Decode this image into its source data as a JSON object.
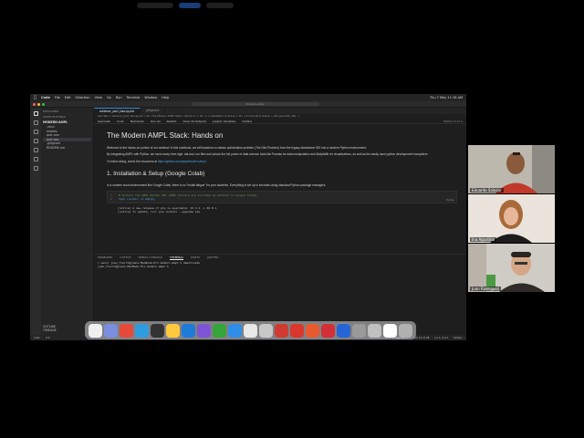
{
  "meeting": {
    "top_hint_text": "",
    "participants": [
      {
        "name": "Eduardo Salazar"
      },
      {
        "name": "Ina Agustina"
      },
      {
        "name": "Juan Rodriguez"
      }
    ]
  },
  "mac_menubar": {
    "app": "Code",
    "menus": [
      "File",
      "Edit",
      "Selection",
      "View",
      "Go",
      "Run",
      "Terminal",
      "Window",
      "Help"
    ],
    "status_right": "Thu 7 May 11:18 AM"
  },
  "vscode": {
    "search_placeholder": "modern-ampl",
    "explorer": {
      "header": "EXPLORER",
      "open_editors": "OPEN EDITORS",
      "folder": "MODERN-AMPL",
      "items": [
        ".venv",
        "models",
        "part-one",
        "part-two",
        ".gitignore",
        "README.md"
      ],
      "selected_index": 3,
      "outline": "OUTLINE",
      "timeline": "TIMELINE"
    },
    "tabs": [
      {
        "label": "webinar_part_two.ipynb",
        "active": true
      },
      {
        "label": "gitignore",
        "active": false
      }
    ],
    "breadcrumbs": "part-two > webinar_part_two.ipynb > M+ The Modern AMPL Stack: Hands on > M+ 1.1 Installation & Setup > M+ 1.2 Imports & Setup > def generate_dfs(...)",
    "nb_toolbar": [
      "Generate",
      "Code",
      "Markdown",
      "Run All",
      "Restart",
      "Clear All Outputs",
      "Jupyter Variables",
      "Outline"
    ],
    "kernel": "Python 3.11.1",
    "notebook": {
      "title": "The Modern AMPL Stack: Hands on",
      "intro": "Welcome to the hands-on portion of our webinar! In this notebook, we will transform a classic optimization problem (The Diet Problem) from the legacy standalone IDE into a modern Python environment.",
      "intro2": "By integrating AMPL with Python, we move away from rigid .dat and .run files and unlock the full power of data science tools like Pandas for data manipulation and Matplotlib for visualizations, as well as the easily used python development ecosystem.",
      "follow": "To follow along, check the resources at",
      "follow_link": "https://github.com/ampl/modern-ampl",
      "section": "1. Installation & Setup (Google Colab)",
      "section_text": "In a modern cloud environment like Google Colab, there is no \"install fatigue\" for your students. Everything is set up in seconds using standard Python package managers.",
      "code_lines": [
        {
          "ln": "1",
          "text": "# Install the AMPL Python API (AMPL Solvers are included by default in Google Colab)"
        },
        {
          "ln": "2",
          "text": "%pip install -U amplpy"
        }
      ],
      "code_lang": "Python",
      "output_lines": [
        "[notice] A new release of pip is available: 23.3.1 -> 26.0.1",
        "[notice] To update, run: pip install --upgrade pip"
      ]
    },
    "panel_tabs": [
      "PROBLEMS",
      "OUTPUT",
      "DEBUG CONSOLE",
      "TERMINAL",
      "PORTS",
      "JUPYTER"
    ],
    "active_panel": "TERMINAL",
    "terminal_lines": [
      "(.venv) juan_fierro@juans-MacBook-Pro modern-ampl % deactivate",
      "juan_fierro@juans-MacBook-Pro modern-ampl % "
    ],
    "statusbar_left": [
      "main",
      "0 0"
    ],
    "statusbar_right": [
      "Spaces: 4",
      "Cell 10 of 28",
      "Ln 1, Col 1",
      "Python"
    ]
  },
  "dock_colors": [
    "#f0f0f0",
    "#7b8ee0",
    "#e64a3a",
    "#2d9de0",
    "#333333",
    "#ffc83d",
    "#1e7cd8",
    "#7d54d6",
    "#36a53a",
    "#2f8fe8",
    "#e8e8e8",
    "#c8c8c8",
    "#cf3b30",
    "#d9372b",
    "#e85a2e",
    "#d22f38",
    "#2565d6",
    "#9a9a9a",
    "#c0c0c0",
    "#ffffff",
    "#b0b0b0"
  ]
}
